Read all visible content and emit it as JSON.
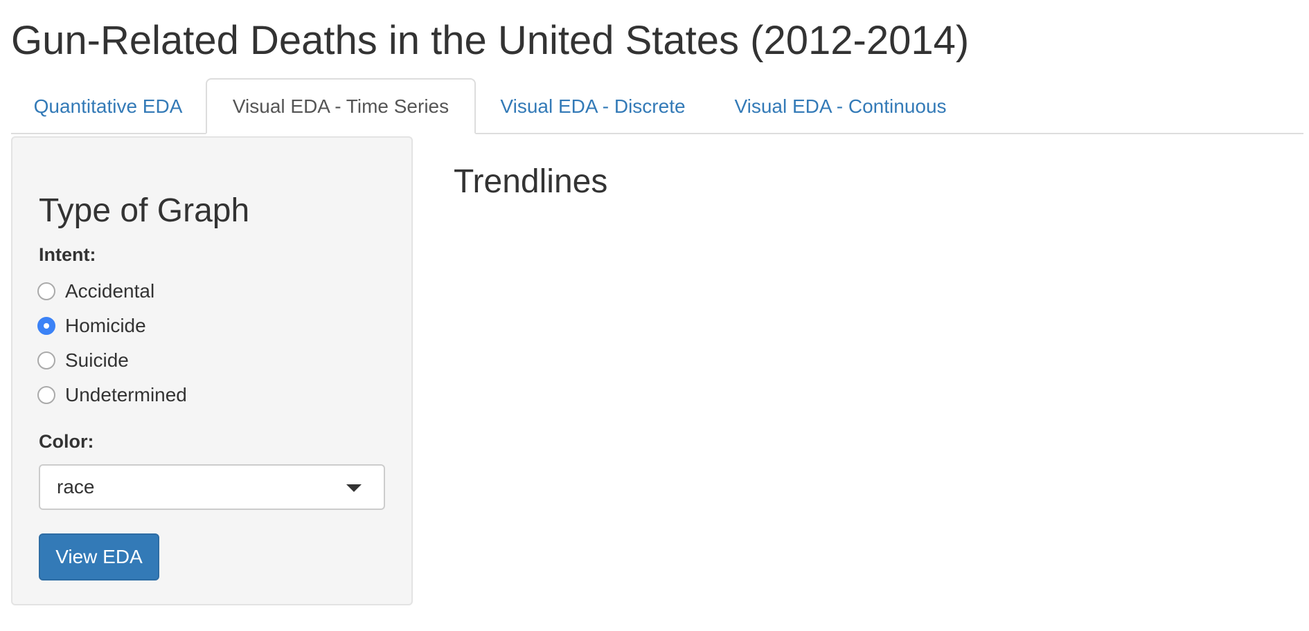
{
  "app": {
    "title": "Gun-Related Deaths in the United States (2012-2014)"
  },
  "tabs": [
    {
      "label": "Quantitative EDA",
      "active": false
    },
    {
      "label": "Visual EDA - Time Series",
      "active": true
    },
    {
      "label": "Visual EDA - Discrete",
      "active": false
    },
    {
      "label": "Visual EDA - Continuous",
      "active": false
    }
  ],
  "sidebar": {
    "heading": "Type of Graph",
    "intent": {
      "label": "Intent:",
      "options": [
        {
          "label": "Accidental",
          "checked": false
        },
        {
          "label": "Homicide",
          "checked": true
        },
        {
          "label": "Suicide",
          "checked": false
        },
        {
          "label": "Undetermined",
          "checked": false
        }
      ]
    },
    "color": {
      "label": "Color:",
      "selected": "race"
    },
    "button_label": "View EDA"
  },
  "main": {
    "heading": "Trendlines"
  },
  "colors": {
    "link": "#337ab7",
    "primary_button": "#337ab7",
    "radio_checked": "#3b82f6",
    "sidebar_bg": "#f5f5f5"
  },
  "icons": {
    "select_caret": "chevron-down-icon"
  }
}
